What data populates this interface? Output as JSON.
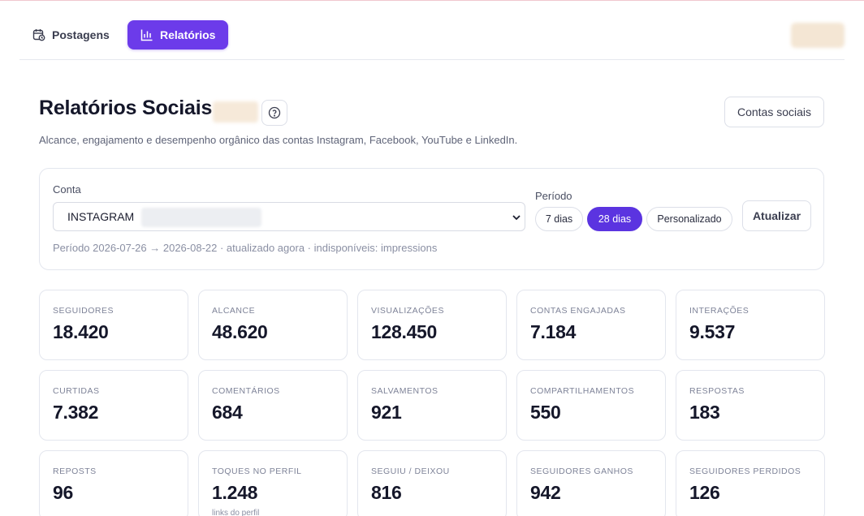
{
  "nav": {
    "postagens": "Postagens",
    "relatorios": "Relatórios"
  },
  "header": {
    "title": "Relatórios Sociais",
    "subtitle": "Alcance, engajamento e desempenho orgânico das contas Instagram, Facebook, YouTube e LinkedIn.",
    "contas_button": "Contas sociais"
  },
  "filters": {
    "conta_label": "Conta",
    "conta_value": "INSTAGRAM",
    "periodo_label": "Período",
    "periods": [
      "7 dias",
      "28 dias",
      "Personalizado"
    ],
    "active_period": "28 dias",
    "atualizar": "Atualizar",
    "meta": "Período 2026-07-26 → 2026-08-22 · atualizado agora · indisponíveis: impressions"
  },
  "metrics": [
    {
      "label": "SEGUIDORES",
      "value": "18.420"
    },
    {
      "label": "ALCANCE",
      "value": "48.620"
    },
    {
      "label": "VISUALIZAÇÕES",
      "value": "128.450"
    },
    {
      "label": "CONTAS ENGAJADAS",
      "value": "7.184"
    },
    {
      "label": "INTERAÇÕES",
      "value": "9.537"
    },
    {
      "label": "CURTIDAS",
      "value": "7.382"
    },
    {
      "label": "COMENTÁRIOS",
      "value": "684"
    },
    {
      "label": "SALVAMENTOS",
      "value": "921"
    },
    {
      "label": "COMPARTILHAMENTOS",
      "value": "550"
    },
    {
      "label": "RESPOSTAS",
      "value": "183"
    },
    {
      "label": "REPOSTS",
      "value": "96"
    },
    {
      "label": "TOQUES NO PERFIL",
      "value": "1.248",
      "note": "links do perfil"
    },
    {
      "label": "SEGUIU / DEIXOU",
      "value": "816"
    },
    {
      "label": "SEGUIDORES GANHOS",
      "value": "942"
    },
    {
      "label": "SEGUIDORES PERDIDOS",
      "value": "126"
    }
  ],
  "colors": {
    "accent": "#6c3bea",
    "active_period": "#5b34e0"
  }
}
